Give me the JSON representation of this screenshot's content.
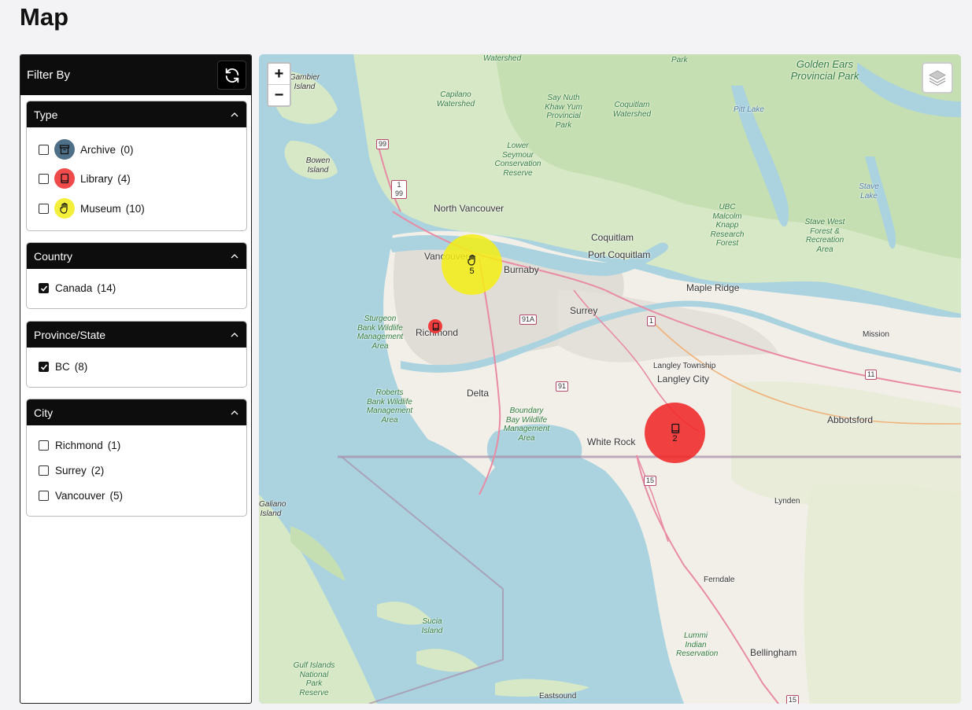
{
  "page": {
    "title": "Map"
  },
  "sidebar": {
    "title": "Filter By",
    "sections": {
      "type": {
        "title": "Type",
        "options": [
          {
            "label": "Archive",
            "count": "(0)",
            "checked": false,
            "icon": "archive-icon",
            "color": "#4d6f88"
          },
          {
            "label": "Library",
            "count": "(4)",
            "checked": false,
            "icon": "book-icon",
            "color": "#f04a4a"
          },
          {
            "label": "Museum",
            "count": "(10)",
            "checked": false,
            "icon": "hand-icon",
            "color": "#f4ef3a"
          }
        ]
      },
      "country": {
        "title": "Country",
        "options": [
          {
            "label": "Canada",
            "count": "(14)",
            "checked": true
          }
        ]
      },
      "province": {
        "title": "Province/State",
        "options": [
          {
            "label": "BC",
            "count": "(8)",
            "checked": true
          }
        ]
      },
      "city": {
        "title": "City",
        "options": [
          {
            "label": "Richmond",
            "count": "(1)",
            "checked": false
          },
          {
            "label": "Surrey",
            "count": "(2)",
            "checked": false
          },
          {
            "label": "Vancouver",
            "count": "(5)",
            "checked": false
          }
        ]
      }
    }
  },
  "map": {
    "zoom_in": "+",
    "zoom_out": "−",
    "clusters": [
      {
        "count": "5",
        "type": "museum",
        "color": "#f4ef1f"
      },
      {
        "count": "2",
        "type": "library",
        "color": "#f03636"
      }
    ],
    "places": {
      "north_vancouver": "North Vancouver",
      "vancouver": "Vancouver",
      "burnaby": "Burnaby",
      "coquitlam": "Coquitlam",
      "port_coquitlam": "Port Coquitlam",
      "maple_ridge": "Maple Ridge",
      "surrey": "Surrey",
      "richmond": "Richmond",
      "delta": "Delta",
      "langley_township": "Langley Township",
      "langley_city": "Langley City",
      "white_rock": "White Rock",
      "abbotsford": "Abbotsford",
      "mission": "Mission",
      "lynden": "Lynden",
      "ferndale": "Ferndale",
      "bellingham": "Bellingham",
      "eastsound": "Eastsound"
    },
    "parks": {
      "golden_ears": "Golden Ears Provincial Park",
      "capilano": "Capilano Watershed",
      "seymour_top": "Watershed",
      "say_nuth": "Say Nuth Khaw Yum Provincial Park",
      "coquitlam_ws": "Coquitlam Watershed",
      "lower_seymour": "Lower Seymour Conservation Reserve",
      "ubc_forest": "UBC Malcolm Knapp Research Forest",
      "stave_west": "Stave West Forest & Recreation Area",
      "sturgeon": "Sturgeon Bank Wildlife Management Area",
      "roberts": "Roberts Bank Wildlife Management Area",
      "boundary": "Boundary Bay Wildlife Management Area",
      "sucia": "Sucia Island",
      "gulf": "Gulf Islands National Park Reserve",
      "lummi": "Lummi Indian Reservation",
      "gambier": "Gambier Island",
      "bowen": "Bowen Island",
      "pitt": "Pitt Lake",
      "stave": "Stave Lake",
      "galiano": "Galiano Island",
      "park_top": "Park"
    },
    "shields": [
      "99",
      "1 99",
      "91A",
      "1",
      "91",
      "11",
      "15",
      "15"
    ]
  }
}
